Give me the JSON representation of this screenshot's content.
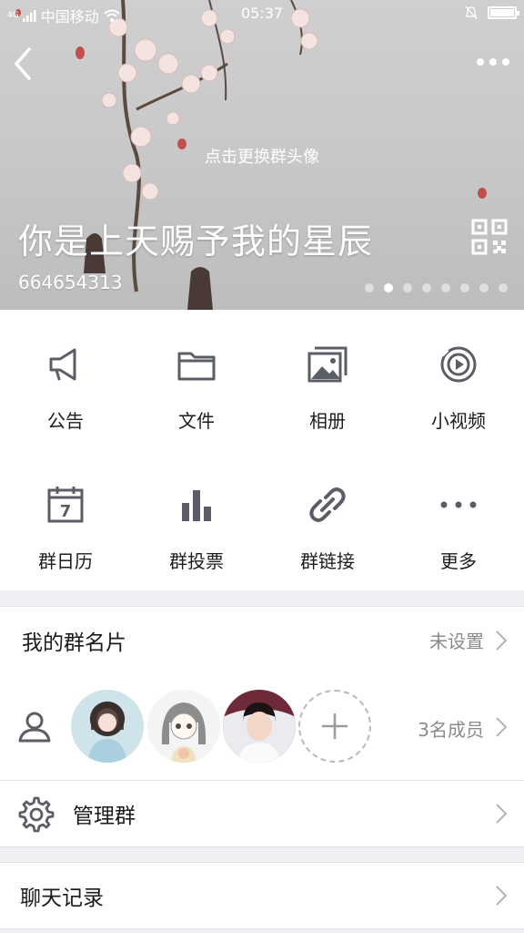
{
  "status_bar": {
    "network": "4G",
    "carrier": "中国移动",
    "time": "05:37"
  },
  "header": {
    "change_avatar_hint": "点击更换群头像",
    "group_name": "你是上天赐予我的星辰",
    "group_id": "664654313",
    "page_dots": 8,
    "active_dot": 1
  },
  "grid": {
    "items": [
      {
        "label": "公告",
        "icon": "megaphone-icon"
      },
      {
        "label": "文件",
        "icon": "folder-icon"
      },
      {
        "label": "相册",
        "icon": "album-icon"
      },
      {
        "label": "小视频",
        "icon": "video-icon"
      },
      {
        "label": "群日历",
        "icon": "calendar-icon"
      },
      {
        "label": "群投票",
        "icon": "bar-chart-icon"
      },
      {
        "label": "群链接",
        "icon": "link-icon"
      },
      {
        "label": "更多",
        "icon": "more-dots-icon"
      }
    ],
    "calendar_day": "7"
  },
  "card": {
    "title": "我的群名片",
    "value": "未设置"
  },
  "members": {
    "count_label": "3名成员"
  },
  "manage": {
    "title": "管理群"
  },
  "chat_history": {
    "title": "聊天记录"
  },
  "colors": {
    "icon_gray": "#5b5e66",
    "text_dark": "#1c1c1c",
    "text_muted": "#8a8a8f",
    "page_bg": "#efeff4"
  }
}
